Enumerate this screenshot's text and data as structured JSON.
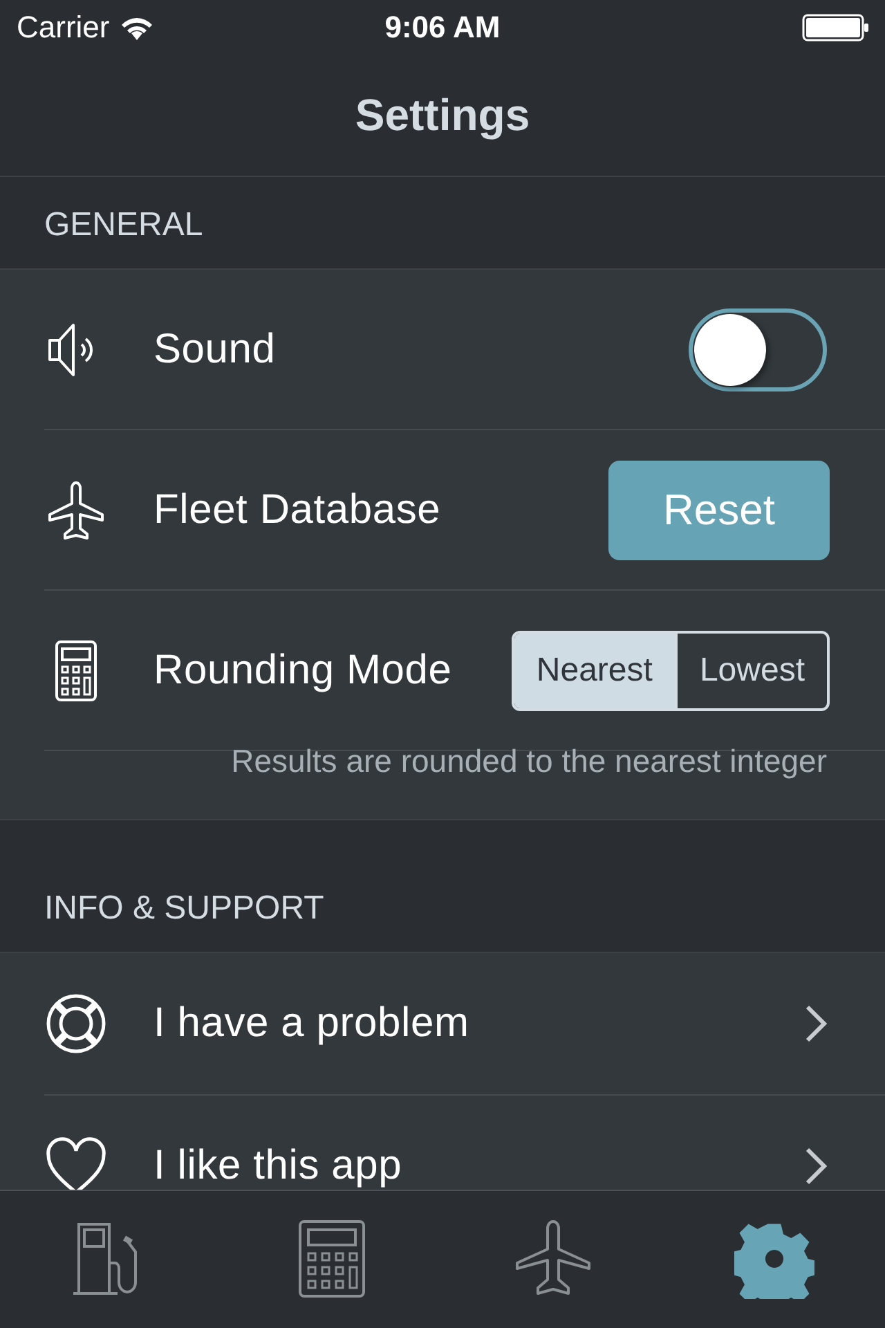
{
  "status_bar": {
    "carrier": "Carrier",
    "time": "9:06 AM"
  },
  "nav": {
    "title": "Settings"
  },
  "sections": [
    {
      "header": "GENERAL",
      "rows": [
        {
          "kind": "toggle",
          "label": "Sound",
          "on": false
        },
        {
          "kind": "button",
          "label": "Fleet Database",
          "button": "Reset"
        },
        {
          "kind": "segmented",
          "label": "Rounding Mode",
          "segments": [
            {
              "label": "Nearest",
              "selected": true
            },
            {
              "label": "Lowest",
              "selected": false
            }
          ]
        }
      ],
      "footer": "Results are rounded to the nearest integer"
    },
    {
      "header": "INFO & SUPPORT",
      "rows": [
        {
          "kind": "link",
          "label": "I have a problem"
        },
        {
          "kind": "link",
          "label": "I like this app"
        }
      ]
    }
  ],
  "tab_bar": [
    {
      "selected": false
    },
    {
      "selected": false
    },
    {
      "selected": false
    },
    {
      "selected": true
    }
  ]
}
